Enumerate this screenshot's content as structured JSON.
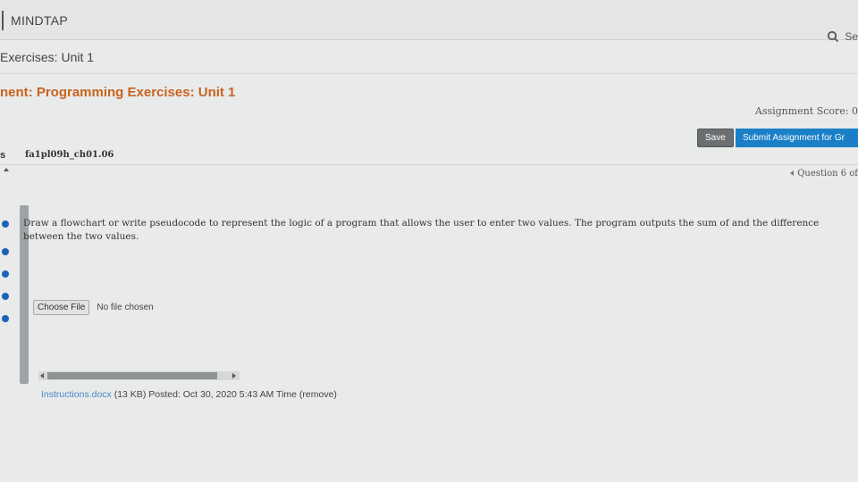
{
  "header": {
    "brand": "MINDTAP",
    "search_label": "Se"
  },
  "breadcrumb": "Exercises: Unit 1",
  "assignment": {
    "title": "nent: Programming Exercises: Unit 1",
    "score_label": "Assignment Score: 0",
    "save_label": "Save",
    "submit_label": "Submit Assignment for Gr"
  },
  "sidebar": {
    "tab_label": "s"
  },
  "question": {
    "file_title": "fa1pl09h_ch01.06",
    "nav_label": "Question 6 of",
    "prompt": "Draw a flowchart or write pseudocode to represent the logic of a program that allows the user to enter two values. The program outputs the sum of and the difference between the two values.",
    "choose_file_label": "Choose File",
    "no_file_label": "No file chosen"
  },
  "attachment": {
    "name": "Instructions.docx",
    "details": " (13 KB) Posted: Oct 30, 2020 5:43 AM Time (remove)"
  },
  "colors": {
    "assignment_title": "#c8641e",
    "submit_button": "#1a7fc7",
    "status_dot": "#1c63b8"
  }
}
